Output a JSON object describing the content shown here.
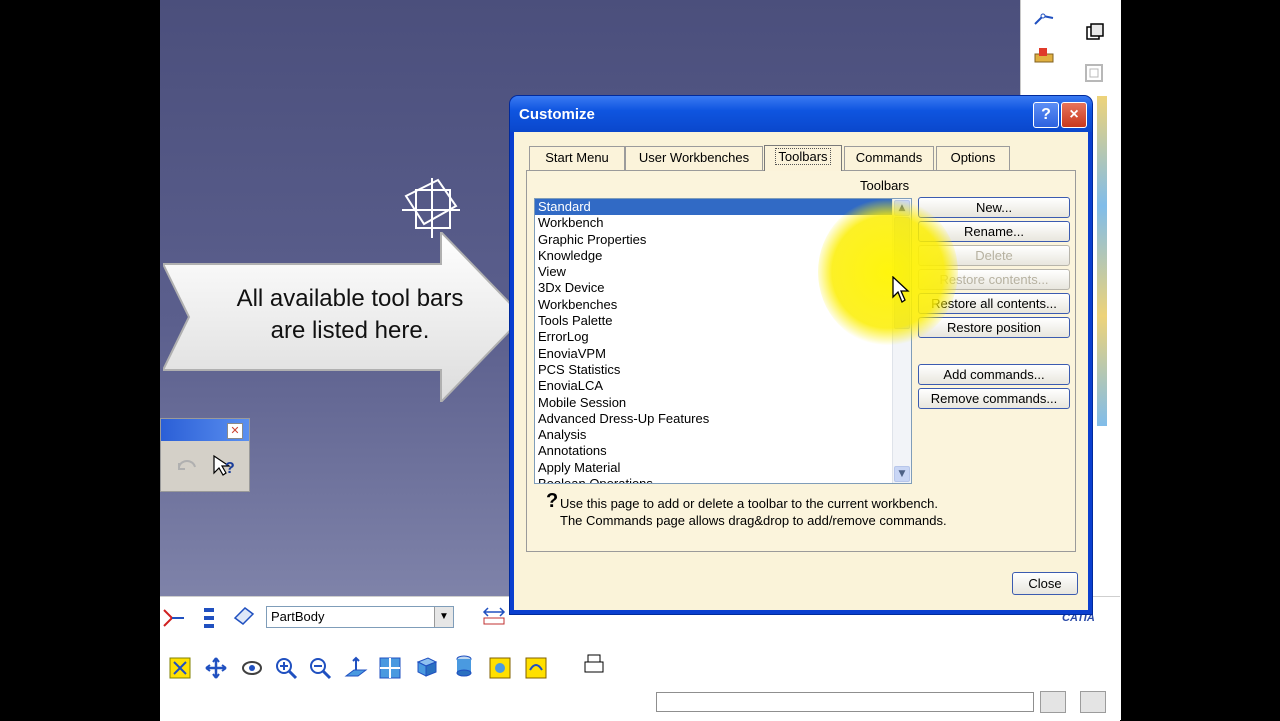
{
  "app": {
    "workbench_combo_value": "PartBody",
    "logo_text": "CATIA"
  },
  "callout": {
    "line1": "All available tool bars",
    "line2": "are listed here."
  },
  "dialog": {
    "title": "Customize",
    "help_glyph": "?",
    "close_glyph": "×",
    "tabs": [
      {
        "label": "Start Menu",
        "active": false
      },
      {
        "label": "User Workbenches",
        "active": false
      },
      {
        "label": "Toolbars",
        "active": true
      },
      {
        "label": "Commands",
        "active": false
      },
      {
        "label": "Options",
        "active": false
      }
    ],
    "list_header": "Toolbars",
    "toolbars": [
      "Standard",
      "Workbench",
      "Graphic Properties",
      "Knowledge",
      "View",
      "3Dx Device",
      "Workbenches",
      "Tools Palette",
      "ErrorLog",
      "EnoviaVPM",
      "PCS Statistics",
      "EnoviaLCA",
      "Mobile Session",
      "Advanced Dress-Up Features",
      "Analysis",
      "Annotations",
      "Apply Material",
      "Boolean Operations"
    ],
    "selected_toolbar": "Standard",
    "buttons": {
      "new": "New...",
      "rename": "Rename...",
      "delete": "Delete",
      "restore_contents": "Restore contents...",
      "restore_all": "Restore all contents...",
      "restore_position": "Restore position",
      "add_commands": "Add commands...",
      "remove_commands": "Remove commands..."
    },
    "hint_line1": "Use this page to add or delete a toolbar to the current workbench.",
    "hint_line2": "The Commands page allows drag&drop to add/remove commands.",
    "close_label": "Close"
  },
  "colors": {
    "background": "#5b5f8d",
    "dialog_frame": "#0a47cc",
    "dialog_body": "#faf3d9",
    "selection": "#316ac5",
    "highlight": "#fff200"
  }
}
